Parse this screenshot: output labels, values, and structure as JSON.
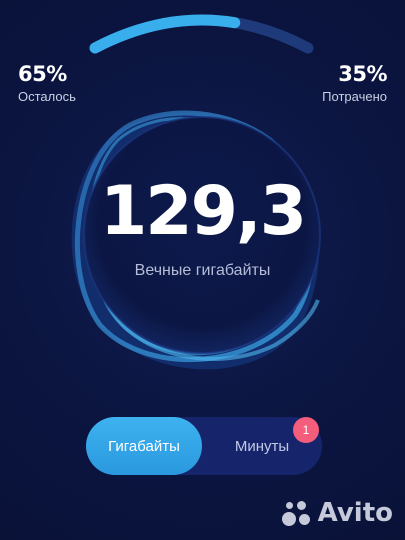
{
  "usage": {
    "remaining_percent_label": "65%",
    "remaining_label": "Осталось",
    "spent_percent_label": "35%",
    "spent_label": "Потрачено",
    "remaining_fraction": 0.65
  },
  "balance": {
    "value": "129,3",
    "caption": "Вечные гигабайты"
  },
  "tabs": [
    {
      "label": "Гигабайты",
      "active": true
    },
    {
      "label": "Минуты",
      "active": false,
      "badge": "1"
    }
  ],
  "watermark": {
    "text": "Avito"
  },
  "colors": {
    "background": "#0b1540",
    "accent": "#39aeed",
    "track": "#1e3a7a",
    "badge": "#f45d7c"
  },
  "icons": {
    "watermark_logo": "avito-logo-icon"
  }
}
